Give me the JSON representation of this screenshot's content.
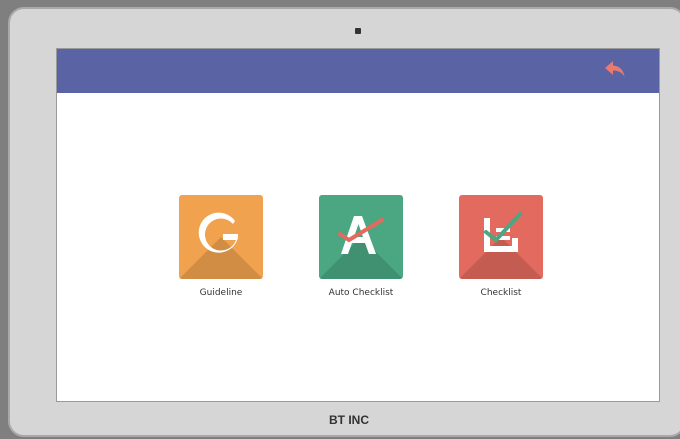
{
  "device": {
    "brand": "BT INC"
  },
  "appbar": {
    "back_icon": "reply-icon"
  },
  "apps": [
    {
      "label": "Guideline",
      "icon": "g-letter-icon",
      "color": "#f0a24f"
    },
    {
      "label": "Auto Checklist",
      "icon": "a-check-icon",
      "color": "#4aa782"
    },
    {
      "label": "Checklist",
      "icon": "checklist-box-icon",
      "color": "#e26a5f"
    }
  ],
  "colors": {
    "appbar": "#5a64a5",
    "back_icon": "#e97a6e"
  }
}
